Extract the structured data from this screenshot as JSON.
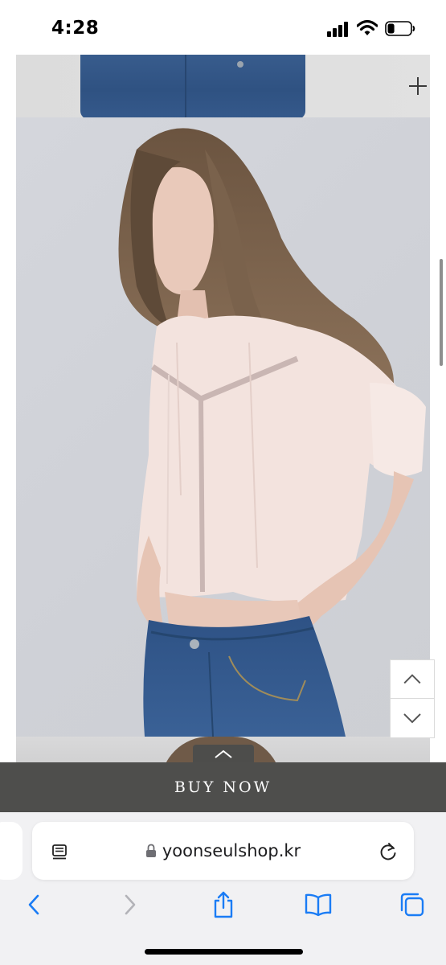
{
  "status_bar": {
    "time": "4:28",
    "signal_icon": "signal-bars-icon",
    "wifi_icon": "wifi-icon",
    "battery_icon": "battery-low-icon",
    "battery_level": 0.3
  },
  "page": {
    "expand_icon": "plus-icon",
    "scroll_up_icon": "chevron-up-icon",
    "scroll_down_icon": "chevron-down-icon",
    "collapse_icon": "chevron-up-icon"
  },
  "buy_bar": {
    "label": "BUY NOW",
    "background": "#4e4e4c",
    "text_color": "#ffffff"
  },
  "browser": {
    "url": "yoonseulshop.kr",
    "reader_icon": "reader-icon",
    "lock_icon": "lock-icon",
    "reload_icon": "reload-icon",
    "toolbar": {
      "back_icon": "chevron-left-icon",
      "forward_icon": "chevron-right-icon",
      "share_icon": "share-icon",
      "bookmarks_icon": "book-icon",
      "tabs_icon": "tabs-icon"
    },
    "accent_color": "#1a7cf5"
  }
}
